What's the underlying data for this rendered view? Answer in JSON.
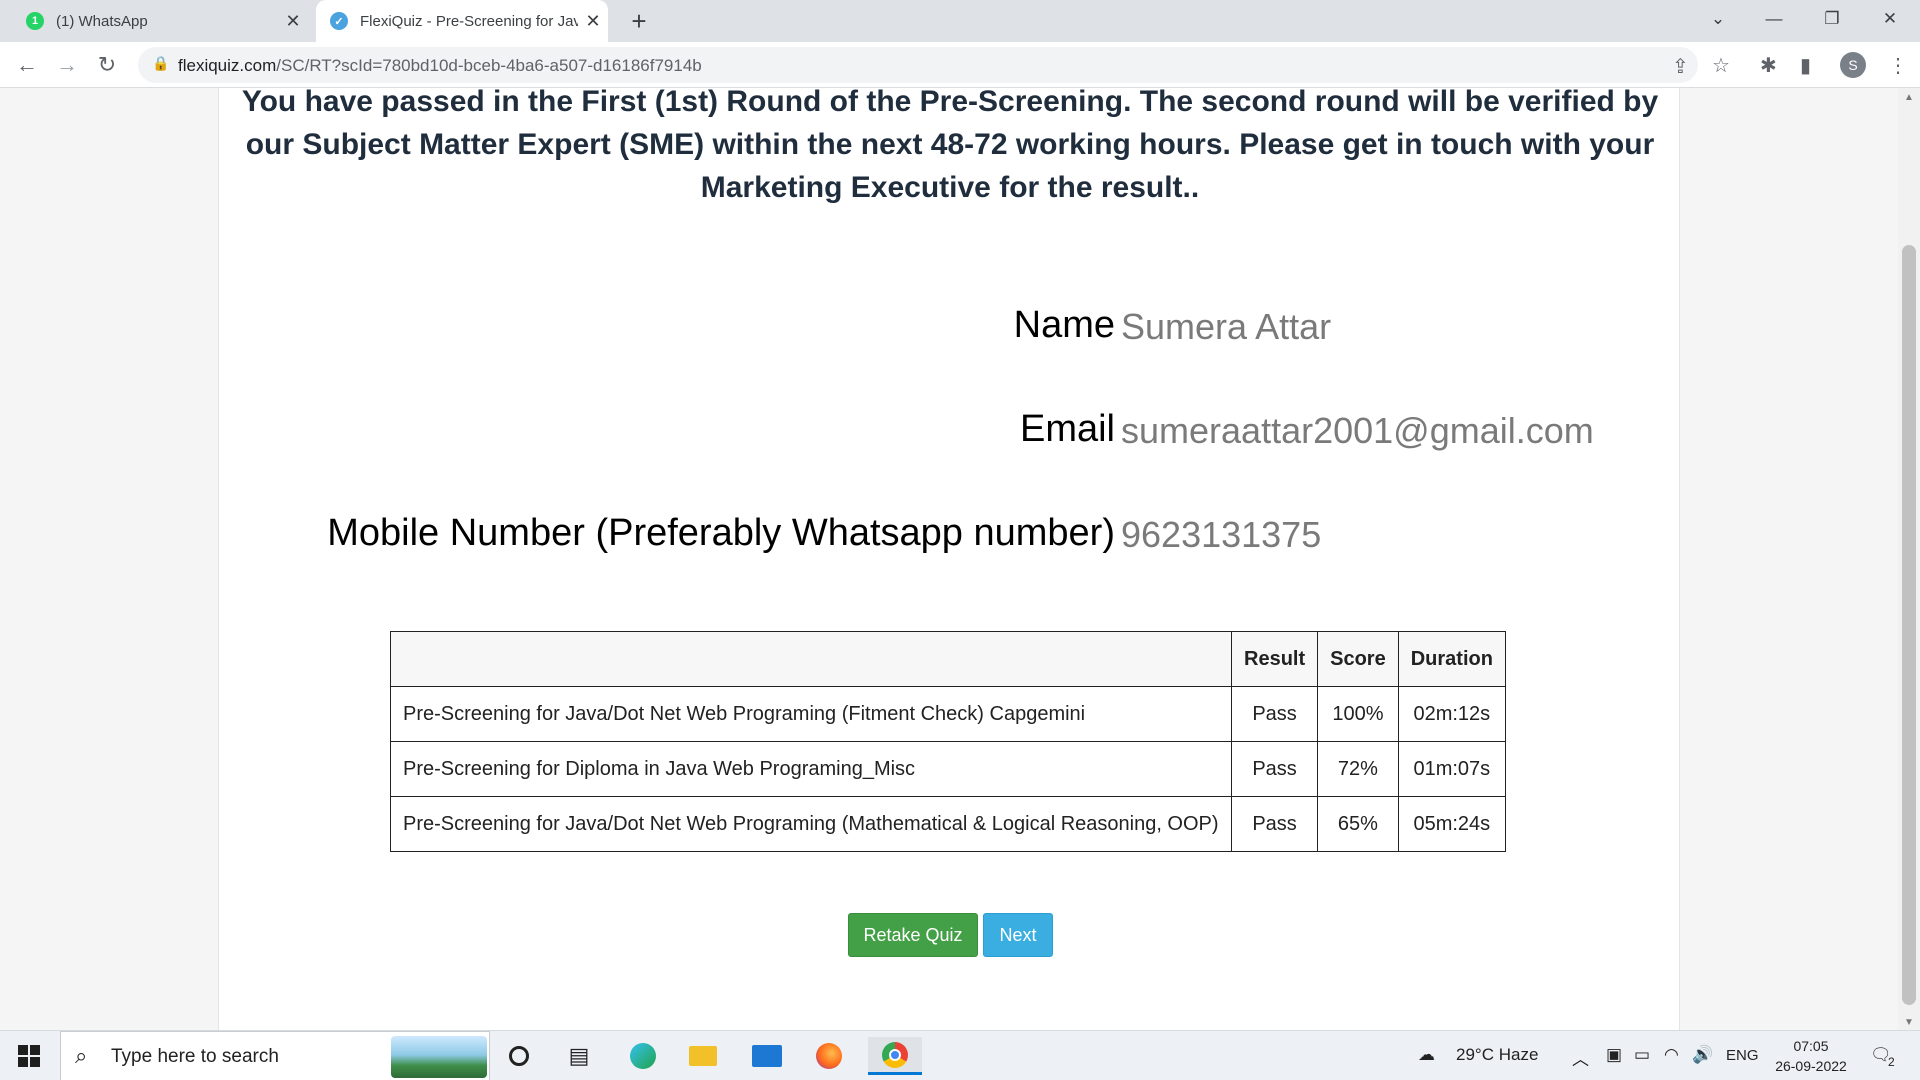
{
  "browser": {
    "tabs": [
      {
        "title": "(1) WhatsApp",
        "icon": "whatsapp-icon",
        "active": false
      },
      {
        "title": "FlexiQuiz - Pre-Screening for Java",
        "icon": "flexiquiz-icon",
        "active": true
      }
    ],
    "url_host": "flexiquiz.com",
    "url_path": "/SC/RT?scId=780bd10d-bceb-4ba6-a507-d16186f7914b",
    "profile_initial": "S"
  },
  "page": {
    "message": "You have passed in the First (1st) Round of the Pre-Screening. The second round will be verified by our Subject Matter Expert (SME) within the next 48-72 working hours. Please get in touch with your Marketing Executive for the result..",
    "fields": [
      {
        "label": "Name",
        "value": "Sumera Attar"
      },
      {
        "label": "Email",
        "value": "sumeraattar2001@gmail.com"
      },
      {
        "label": "Mobile Number (Preferably Whatsapp number)",
        "value": "9623131375"
      }
    ],
    "table": {
      "headers": [
        "",
        "Result",
        "Score",
        "Duration"
      ],
      "rows": [
        {
          "quiz": "Pre-Screening for Java/Dot Net Web Programing (Fitment Check) Capgemini",
          "result": "Pass",
          "score": "100%",
          "duration": "02m:12s"
        },
        {
          "quiz": "Pre-Screening for Diploma in Java Web Programing_Misc",
          "result": "Pass",
          "score": "72%",
          "duration": "01m:07s"
        },
        {
          "quiz": "Pre-Screening for Java/Dot Net Web Programing (Mathematical & Logical Reasoning, OOP)",
          "result": "Pass",
          "score": "65%",
          "duration": "05m:24s"
        }
      ]
    },
    "buttons": {
      "retake": "Retake Quiz",
      "next": "Next"
    }
  },
  "taskbar": {
    "search_placeholder": "Type here to search",
    "weather": "29°C  Haze",
    "language": "ENG",
    "time": "07:05",
    "date": "26-09-2022",
    "notification_count": "2"
  },
  "colors": {
    "retake_button": "#43a047",
    "next_button": "#3aaee0",
    "heading_text": "#1f2d3d",
    "field_value": "#7a7a7a"
  }
}
